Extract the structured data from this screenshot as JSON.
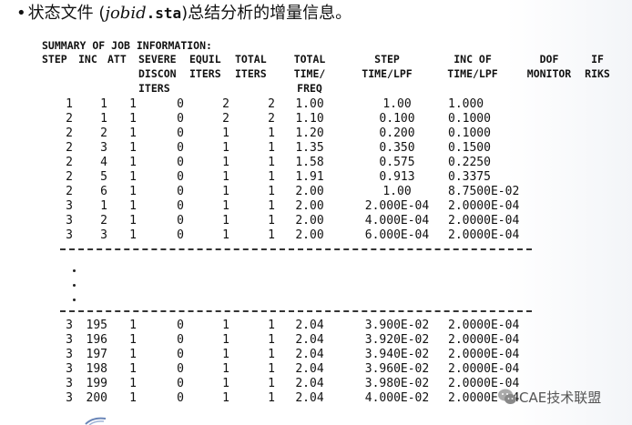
{
  "heading": {
    "bullet": "•",
    "prefix": "状态文件 (",
    "jobid": "jobid",
    "ext": ".sta",
    "suffix": ")总结分析的增量信息。"
  },
  "summary_title": "SUMMARY OF JOB INFORMATION:",
  "headers": {
    "step": "STEP",
    "inc": "INC",
    "att": "ATT",
    "severe": "SEVERE\nDISCON\nITERS",
    "equil": "EQUIL\nITERS",
    "total_iters": "TOTAL\nITERS",
    "total_time": "TOTAL\nTIME/\nFREQ",
    "step_time": "STEP\nTIME/LPF",
    "inc_of": "INC OF\nTIME/LPF",
    "dof": "DOF\nMONITOR",
    "if_riks": "IF\nRIKS"
  },
  "rows_top": [
    [
      "1",
      "1",
      "1",
      "0",
      "2",
      "2",
      "1.00",
      "1.00",
      "1.000"
    ],
    [
      "2",
      "1",
      "1",
      "0",
      "2",
      "2",
      "1.10",
      "0.100",
      "0.1000"
    ],
    [
      "2",
      "2",
      "1",
      "0",
      "1",
      "1",
      "1.20",
      "0.200",
      "0.1000"
    ],
    [
      "2",
      "3",
      "1",
      "0",
      "1",
      "1",
      "1.35",
      "0.350",
      "0.1500"
    ],
    [
      "2",
      "4",
      "1",
      "0",
      "1",
      "1",
      "1.58",
      "0.575",
      "0.2250"
    ],
    [
      "2",
      "5",
      "1",
      "0",
      "1",
      "1",
      "1.91",
      "0.913",
      "0.3375"
    ],
    [
      "2",
      "6",
      "1",
      "0",
      "1",
      "1",
      "2.00",
      "1.00",
      "8.7500E-02"
    ],
    [
      "3",
      "1",
      "1",
      "0",
      "1",
      "1",
      "2.00",
      "2.000E-04",
      "2.0000E-04"
    ],
    [
      "3",
      "2",
      "1",
      "0",
      "1",
      "1",
      "2.00",
      "4.000E-04",
      "2.0000E-04"
    ],
    [
      "3",
      "3",
      "1",
      "0",
      "1",
      "1",
      "2.00",
      "6.000E-04",
      "2.0000E-04"
    ]
  ],
  "ellipsis": ".",
  "rows_bottom": [
    [
      "3",
      "195",
      "1",
      "0",
      "1",
      "1",
      "2.04",
      "3.900E-02",
      "2.0000E-04"
    ],
    [
      "3",
      "196",
      "1",
      "0",
      "1",
      "1",
      "2.04",
      "3.920E-02",
      "2.0000E-04"
    ],
    [
      "3",
      "197",
      "1",
      "0",
      "1",
      "1",
      "2.04",
      "3.940E-02",
      "2.0000E-04"
    ],
    [
      "3",
      "198",
      "1",
      "0",
      "1",
      "1",
      "2.04",
      "3.960E-02",
      "2.0000E-04"
    ],
    [
      "3",
      "199",
      "1",
      "0",
      "1",
      "1",
      "2.04",
      "3.980E-02",
      "2.0000E-04"
    ],
    [
      "3",
      "200",
      "1",
      "0",
      "1",
      "1",
      "2.04",
      "4.000E-02",
      "2.0000E-04"
    ]
  ],
  "watermark": "CAE技术联盟",
  "watermark_icon": "wechat-icon"
}
